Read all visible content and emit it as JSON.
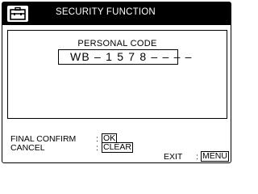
{
  "header": {
    "icon": "briefcase-menu-icon",
    "title": "SECURITY FUNCTION"
  },
  "personal_code": {
    "label": "PERSONAL CODE",
    "value": "WB – 1 5 7 8 – – – –"
  },
  "options": {
    "final_confirm_label": "FINAL CONFIRM",
    "final_confirm_sep": ":",
    "final_confirm_button": "OK",
    "cancel_label": "CANCEL",
    "cancel_sep": ":",
    "cancel_button": "CLEAR",
    "exit_label": "EXIT",
    "exit_sep": ":",
    "exit_button": "MENU"
  }
}
